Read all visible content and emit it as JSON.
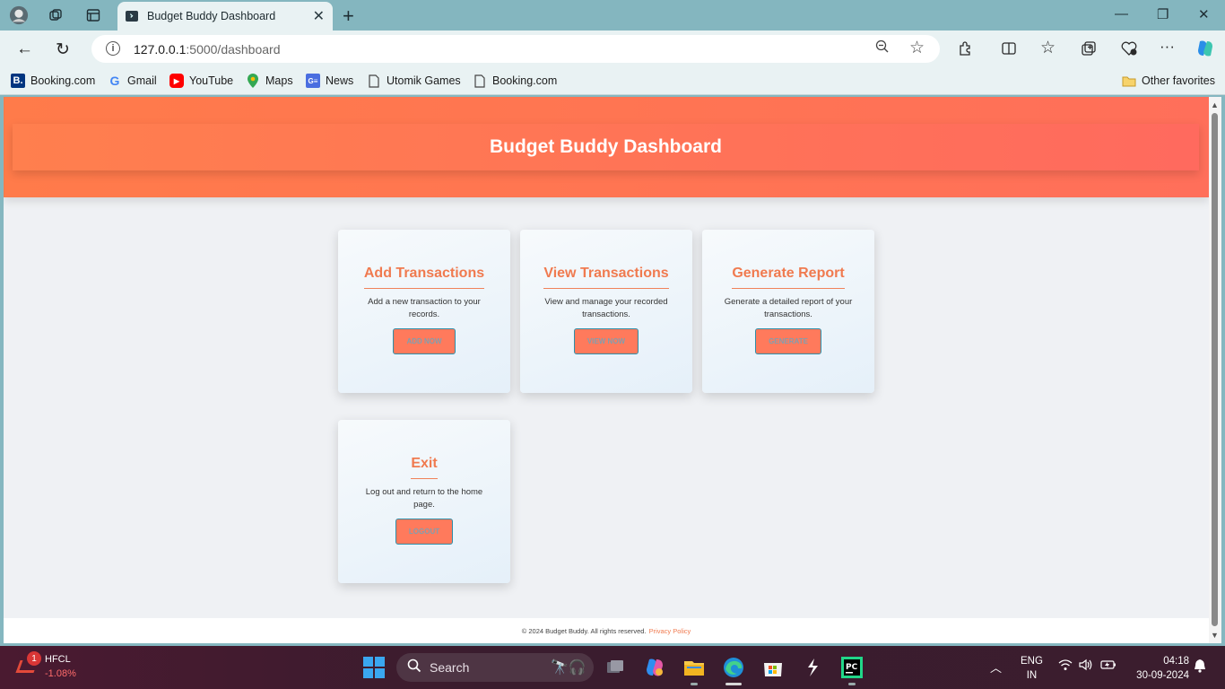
{
  "browser": {
    "tab": {
      "title": "Budget Buddy Dashboard"
    },
    "address": {
      "host": "127.0.0.1",
      "rest": ":5000/dashboard"
    },
    "bookmarks": [
      {
        "label": "Booking.com",
        "icon": "booking-icon",
        "color": "#003580"
      },
      {
        "label": "Gmail",
        "icon": "google-icon",
        "color": "#4285f4"
      },
      {
        "label": "YouTube",
        "icon": "youtube-icon",
        "color": "#ff0000"
      },
      {
        "label": "Maps",
        "icon": "maps-icon",
        "color": "#34a853"
      },
      {
        "label": "News",
        "icon": "news-icon",
        "color": "#4a6ee0"
      },
      {
        "label": "Utomik Games",
        "icon": "page-icon",
        "color": "#444444"
      },
      {
        "label": "Booking.com",
        "icon": "page-icon",
        "color": "#444444"
      }
    ],
    "other_favorites": "Other favorites"
  },
  "page": {
    "header_title": "Budget Buddy Dashboard",
    "cards": [
      {
        "title": "Add Transactions",
        "desc": "Add a new transaction to your records.",
        "button": "ADD NOW"
      },
      {
        "title": "View Transactions",
        "desc": "View and manage your recorded transactions.",
        "button": "VIEW NOW"
      },
      {
        "title": "Generate Report",
        "desc": "Generate a detailed report of your transactions.",
        "button": "GENERATE"
      },
      {
        "title": "Exit",
        "desc": "Log out and return to the home page.",
        "button": "LOGOUT"
      }
    ],
    "footer": {
      "text": "© 2024 Budget Buddy. All rights reserved.",
      "link": "Privacy Policy"
    },
    "colors": {
      "accent": "#ff7a5c",
      "title": "#f07a4f",
      "button_border": "#2e8ea8"
    }
  },
  "taskbar": {
    "stock": {
      "name": "HFCL",
      "change": "-1.08%",
      "badge": "1"
    },
    "search_placeholder": "Search",
    "language": {
      "top": "ENG",
      "bottom": "IN"
    },
    "time": "04:18",
    "date": "30-09-2024"
  }
}
